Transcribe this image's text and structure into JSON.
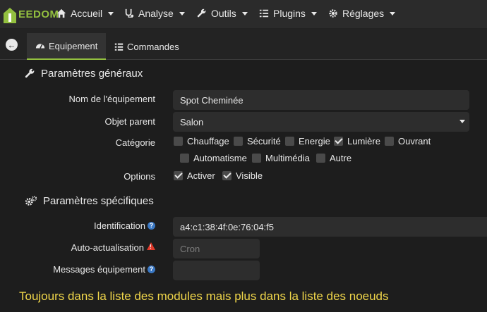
{
  "nav": {
    "logo_text": "EEDOM",
    "items": [
      {
        "label": "Accueil",
        "icon": "home-icon"
      },
      {
        "label": "Analyse",
        "icon": "stethoscope-icon"
      },
      {
        "label": "Outils",
        "icon": "wrench-icon"
      },
      {
        "label": "Plugins",
        "icon": "tasks-icon"
      },
      {
        "label": "Réglages",
        "icon": "gears-icon"
      }
    ]
  },
  "tabs": {
    "back_icon": "back-arrow-icon",
    "items": [
      {
        "label": "Equipement",
        "icon": "tachometer-icon",
        "active": true
      },
      {
        "label": "Commandes",
        "icon": "list-icon",
        "active": false
      }
    ]
  },
  "general": {
    "title": "Paramètres généraux",
    "name_label": "Nom de l'équipement",
    "name_value": "Spot Cheminée",
    "parent_label": "Objet parent",
    "parent_value": "Salon",
    "category_label": "Catégorie",
    "categories": [
      {
        "label": "Chauffage",
        "checked": false
      },
      {
        "label": "Sécurité",
        "checked": false
      },
      {
        "label": "Energie",
        "checked": false
      },
      {
        "label": "Lumière",
        "checked": true
      },
      {
        "label": "Ouvrant",
        "checked": false
      },
      {
        "label": "Automatisme",
        "checked": false
      },
      {
        "label": "Multimédia",
        "checked": false
      },
      {
        "label": "Autre",
        "checked": false
      }
    ],
    "options_label": "Options",
    "options": [
      {
        "label": "Activer",
        "checked": true
      },
      {
        "label": "Visible",
        "checked": true
      }
    ]
  },
  "specific": {
    "title": "Paramètres spécifiques",
    "identification_label": "Identification",
    "identification_value": "a4:c1:38:4f:0e:76:04:f5",
    "refresh_label": "Auto-actualisation",
    "refresh_placeholder": "Cron",
    "messages_label": "Messages équipement"
  },
  "note": "Toujours dans la liste des modules mais plus dans la liste des noeuds",
  "colors": {
    "accent": "#93c03f",
    "note": "#f0d64a",
    "warning": "#e03a2b",
    "help": "#3a78c4"
  }
}
